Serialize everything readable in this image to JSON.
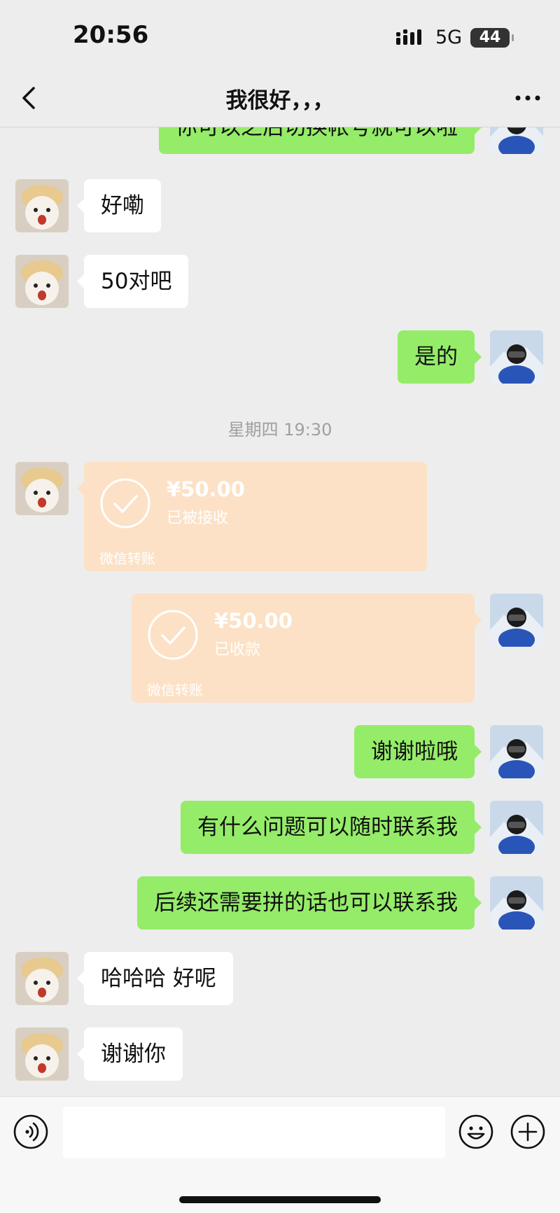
{
  "status_bar": {
    "time": "20:56",
    "network": "5G",
    "battery": "44"
  },
  "nav": {
    "title": "我很好，，，"
  },
  "messages": {
    "m0": "你可以之后切换帐号就可以啦",
    "m1": "好嘞",
    "m2": "50对吧",
    "m3": "是的",
    "timestamp": "星期四 19:30",
    "transfer1": {
      "amount": "¥50.00",
      "status": "已被接收",
      "label": "微信转账"
    },
    "transfer2": {
      "amount": "¥50.00",
      "status": "已收款",
      "label": "微信转账"
    },
    "m4": "谢谢啦哦",
    "m5": "有什么问题可以随时联系我",
    "m6": "后续还需要拼的话也可以联系我",
    "m7": "哈哈哈 好呢",
    "m8": "谢谢你"
  },
  "input": {
    "value": ""
  },
  "colors": {
    "background": "#ededed",
    "sent_bubble": "#95ec69",
    "received_bubble": "#ffffff",
    "transfer": "#fce1c6"
  },
  "icons": {
    "back": "chevron-left-icon",
    "more": "more-icon",
    "voice": "voice-icon",
    "emoji": "emoji-icon",
    "plus": "plus-icon"
  }
}
